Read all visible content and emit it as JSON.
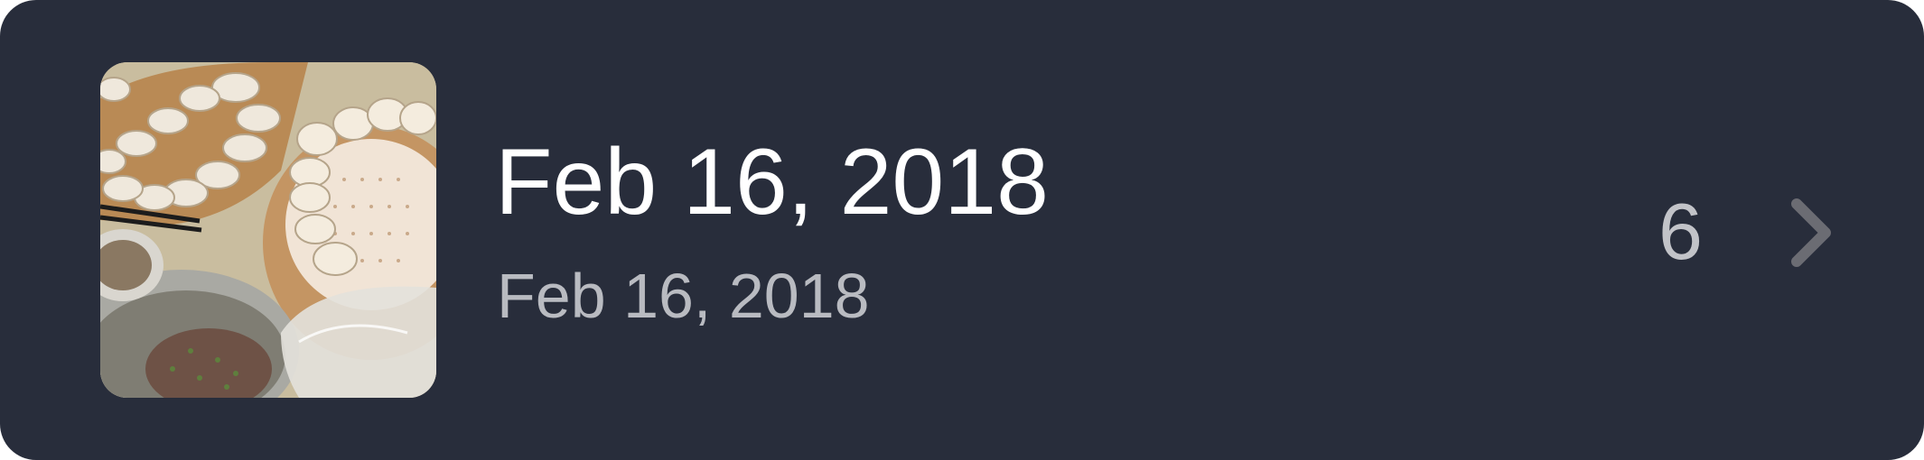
{
  "item": {
    "title": "Feb 16, 2018",
    "subtitle": "Feb 16, 2018",
    "count": "6",
    "thumbnail_icon": "photo-thumbnail",
    "disclosure_icon": "chevron-right-icon"
  },
  "colors": {
    "card_background": "#282d3b",
    "title": "#ffffff",
    "subtitle": "#b9bbc1",
    "count": "#c2c3c8",
    "chevron": "#6b6c73"
  }
}
